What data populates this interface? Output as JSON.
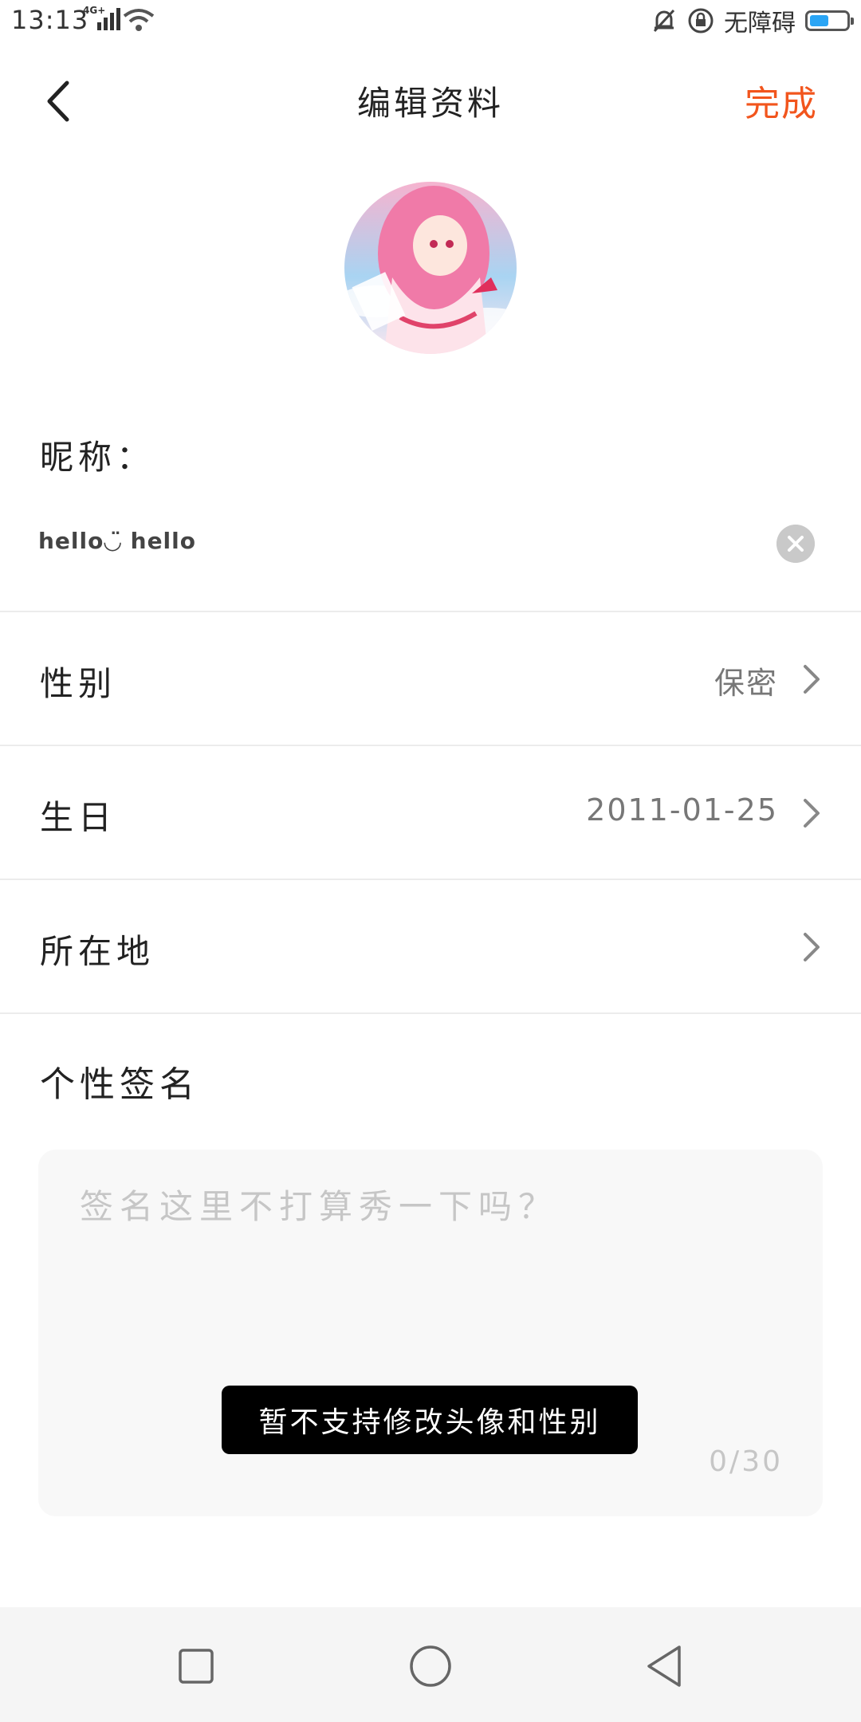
{
  "status_bar": {
    "time": "13:13",
    "network": "4G+",
    "accessibility": "无障碍",
    "battery_level": 0.45,
    "icons": [
      "signal-icon",
      "wifi-icon",
      "mute-bell-icon",
      "rotation-lock-icon",
      "battery-icon"
    ]
  },
  "header": {
    "title": "编辑资料",
    "done_label": "完成"
  },
  "profile": {
    "nickname_label": "昵称：",
    "nickname_value": "hello◡̈ hello"
  },
  "rows": [
    {
      "label": "性别",
      "value": "保密"
    },
    {
      "label": "生日",
      "value": "2011-01-25"
    },
    {
      "label": "所在地",
      "value": ""
    }
  ],
  "signature": {
    "label": "个性签名",
    "placeholder": "签名这里不打算秀一下吗？",
    "count": "0/30"
  },
  "toast": {
    "message": "暂不支持修改头像和性别"
  },
  "colors": {
    "accent": "#f2551d",
    "toast_bg": "#000000",
    "input_bg": "#f8f8f8"
  }
}
